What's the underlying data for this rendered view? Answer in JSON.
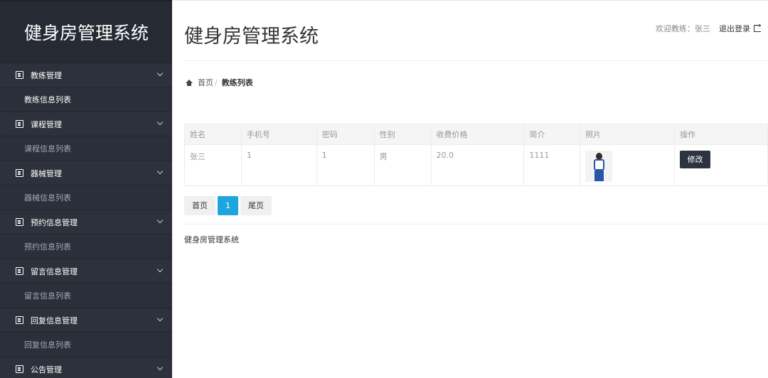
{
  "sidebar": {
    "brand": "健身房管理系统",
    "groups": [
      {
        "label": "教练管理",
        "sub": "教练信息列表"
      },
      {
        "label": "课程管理",
        "sub": "课程信息列表"
      },
      {
        "label": "器械管理",
        "sub": "器械信息列表"
      },
      {
        "label": "预约信息管理",
        "sub": "预约信息列表"
      },
      {
        "label": "留言信息管理",
        "sub": "留言信息列表"
      },
      {
        "label": "回复信息管理",
        "sub": "回复信息列表"
      },
      {
        "label": "公告管理"
      }
    ]
  },
  "header": {
    "title": "健身房管理系统",
    "welcome": "欢迎教练：张三",
    "logout": "退出登录"
  },
  "breadcrumb": {
    "home": "首页",
    "sep": "/",
    "current": "教练列表"
  },
  "table": {
    "columns": [
      "姓名",
      "手机号",
      "密码",
      "性别",
      "收费价格",
      "简介",
      "照片",
      "操作"
    ],
    "rows": [
      {
        "name": "张三",
        "phone": "1",
        "password": "1",
        "gender": "男",
        "price": "20.0",
        "intro": "1111",
        "action": "修改"
      }
    ]
  },
  "pagination": {
    "first": "首页",
    "current": "1",
    "last": "尾页"
  },
  "footer": {
    "text": "健身房管理系统"
  },
  "colors": {
    "sidebar_bg": "#2b2f3a",
    "accent": "#1ea5e0",
    "button_dark": "#2d3340"
  }
}
